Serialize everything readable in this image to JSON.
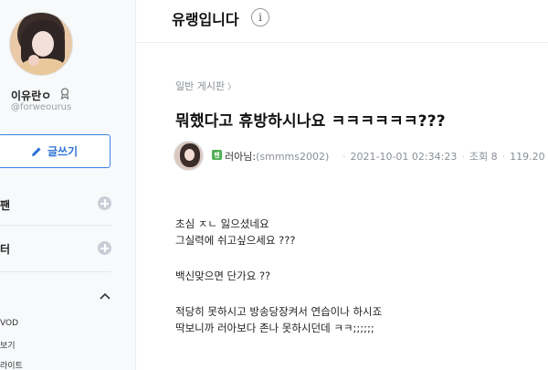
{
  "sidebar": {
    "user_name": "이유란ㅇ",
    "user_handle": "@forweourus",
    "write_button_label": "글쓰기",
    "sections": [
      {
        "label": "팬"
      },
      {
        "label": "터"
      }
    ],
    "sub_items": [
      {
        "label": "VOD"
      },
      {
        "label": "보기"
      },
      {
        "label": "라이트"
      }
    ]
  },
  "header": {
    "title": "유랭입니다",
    "info_glyph": "i"
  },
  "post": {
    "board": "일반 게시판",
    "board_arrow": "〉",
    "title": "뭐했다고 휴방하시나요 ㅋㅋㅋㅋㅋㅋ???",
    "author_level": "팬",
    "author_name": "러아님",
    "author_id": "(smmms2002)",
    "date": "2021-10-01 02:34:23",
    "views": "조회 8",
    "extra": "119.20",
    "body_lines": [
      "초심 ㅈㄴ 잃으셨네요",
      "그실력에 쉬고싶으세요 ???",
      "",
      "백신맞으면 단가요 ??",
      "",
      "적당히 못하시고 방송당장켜서 연습이나 하시죠",
      "딱보니까 러아보다 존나 못하시던데 ㅋㅋ;;;;;;"
    ]
  },
  "colors": {
    "accent": "#2f72d6",
    "sidebar_bg": "#f7f9fb"
  }
}
